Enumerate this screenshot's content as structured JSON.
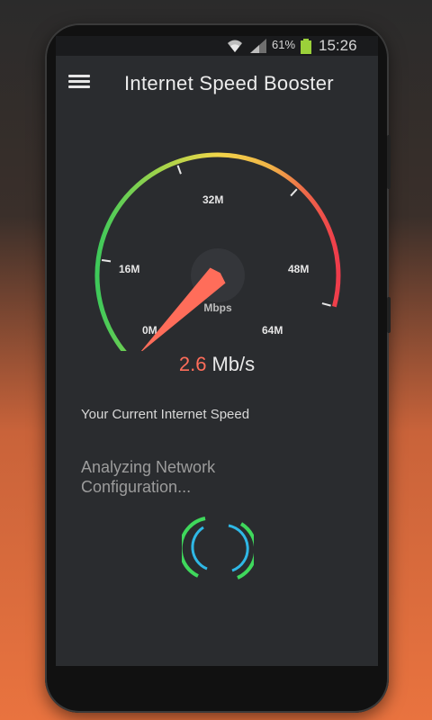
{
  "status": {
    "battery": "61%",
    "time": "15:26"
  },
  "app": {
    "title": "Internet Speed Booster"
  },
  "gauge": {
    "unit": "Mbps",
    "ticks": [
      "0M",
      "16M",
      "32M",
      "48M",
      "64M"
    ],
    "max": 64,
    "current": 2.6
  },
  "speed": {
    "value": "2.6",
    "unit": "Mb/s"
  },
  "labels": {
    "current_speed": "Your Current Internet Speed",
    "analyzing": "Analyzing Network Configuration..."
  },
  "colors": {
    "accent": "#ff6d5a",
    "green": "#44d35a",
    "yellow": "#f2d64a",
    "red": "#ef3b4b"
  },
  "icons": {
    "menu": "menu-icon",
    "wifi": "wifi-icon",
    "signal": "signal-icon",
    "battery": "battery-icon",
    "loader": "spinner-icon"
  }
}
